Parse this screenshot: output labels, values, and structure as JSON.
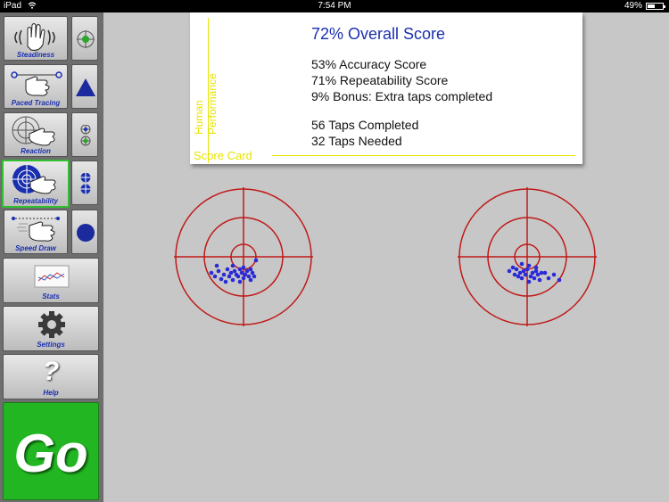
{
  "status_bar": {
    "device": "iPad",
    "time": "7:54 PM",
    "battery": "49%",
    "battery_level": 0.49
  },
  "sidebar": {
    "tools": [
      {
        "label": "Steadiness",
        "active": false
      },
      {
        "label": "Paced Tracing",
        "active": false
      },
      {
        "label": "Reaction",
        "active": false
      },
      {
        "label": "Repeatability",
        "active": true
      },
      {
        "label": "Speed Draw",
        "active": false
      }
    ],
    "stats_label": "Stats",
    "settings_label": "Settings",
    "help_label": "Help",
    "help_glyph": "?",
    "go_label": "Go"
  },
  "score_card": {
    "vertical_title_1": "Human",
    "vertical_title_2": "Performance",
    "card_label": "Score Card",
    "overall": "72%  Overall Score",
    "accuracy": "53%  Accuracy Score",
    "repeatability": "71%  Repeatability Score",
    "bonus": "9%  Bonus: Extra taps completed",
    "taps_completed": "56  Taps Completed",
    "taps_needed": "32  Taps Needed"
  },
  "colors": {
    "accent_blue": "#1a2fb0",
    "target_red": "#c01818",
    "go_green": "#22b722",
    "label_yellow": "#e7e400",
    "dot_blue": "#2a2ad8"
  }
}
